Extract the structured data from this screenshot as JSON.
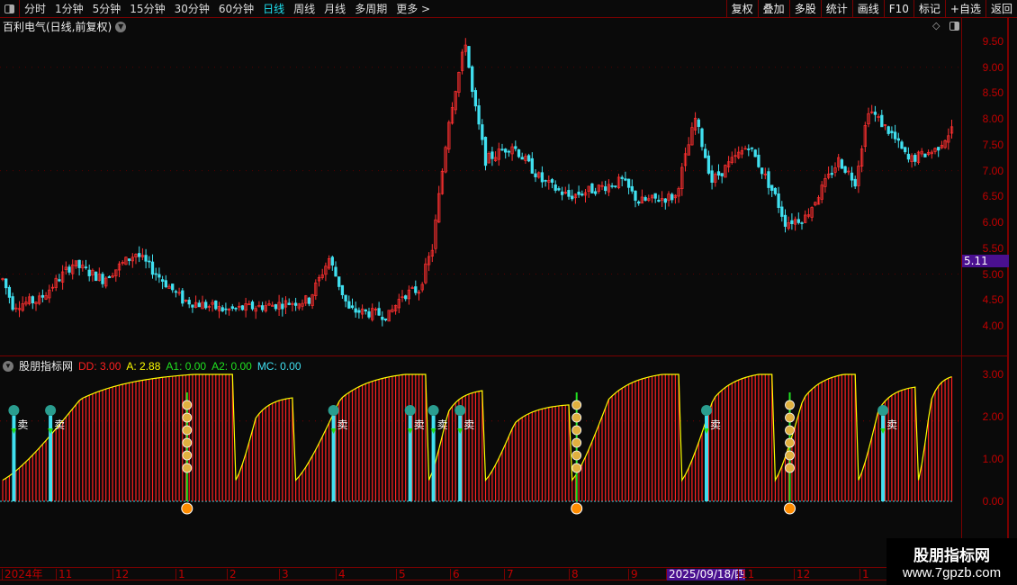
{
  "toolbar": {
    "periods": [
      "分时",
      "1分钟",
      "5分钟",
      "15分钟",
      "30分钟",
      "60分钟",
      "日线",
      "周线",
      "月线",
      "多周期",
      "更多 >"
    ],
    "active_period": "日线",
    "tools": [
      "复权",
      "叠加",
      "多股",
      "统计",
      "画线",
      "F10",
      "标记",
      "+自选",
      "返回"
    ]
  },
  "main": {
    "title": "百利电气(日线,前复权)",
    "current_price": "5.11",
    "y_ticks": [
      "9.50",
      "9.00",
      "8.50",
      "8.00",
      "7.50",
      "7.00",
      "6.50",
      "6.00",
      "5.50",
      "5.00",
      "4.50",
      "4.00"
    ]
  },
  "indicator": {
    "name": "股朋指标网",
    "dd": "DD: 3.00",
    "a": "A: 2.88",
    "a1": "A1: 0.00",
    "a2": "A2: 0.00",
    "mc": "MC: 0.00",
    "y_ticks": [
      "3.00",
      "2.00",
      "1.00",
      "0.00"
    ],
    "sell_label": "卖",
    "sell_signals": [
      2,
      13,
      98,
      121,
      128,
      136,
      210,
      263
    ],
    "buy_signals": [
      54,
      171,
      235
    ]
  },
  "date_axis": {
    "labels": [
      "2024年",
      "11",
      "12",
      "1",
      "2",
      "3",
      "4",
      "5",
      "6",
      "7",
      "8",
      "9",
      "2025/09/18/四",
      "11",
      "12",
      "1"
    ],
    "highlight": "2025/09/18/四"
  },
  "watermark": {
    "line1": "股朋指标网",
    "line2": "www.7gpzb.com"
  },
  "colors": {
    "up": "#ff3030",
    "down": "#40e0f0",
    "curve": "#ffff00",
    "bars": "#ff2020"
  },
  "chart_data": {
    "type": "candlestick",
    "price_path": [
      [
        0,
        4.9
      ],
      [
        3,
        4.4
      ],
      [
        11,
        4.5
      ],
      [
        21,
        5.2
      ],
      [
        30,
        4.9
      ],
      [
        40,
        5.4
      ],
      [
        54,
        4.5
      ],
      [
        67,
        4.3
      ],
      [
        81,
        4.4
      ],
      [
        92,
        4.5
      ],
      [
        98,
        5.3
      ],
      [
        104,
        4.3
      ],
      [
        116,
        4.2
      ],
      [
        120,
        4.6
      ],
      [
        125,
        4.7
      ],
      [
        129,
        5.5
      ],
      [
        134,
        8.0
      ],
      [
        139,
        9.5
      ],
      [
        141,
        8.5
      ],
      [
        145,
        7.2
      ],
      [
        153,
        7.5
      ],
      [
        162,
        6.8
      ],
      [
        170,
        6.5
      ],
      [
        186,
        6.8
      ],
      [
        191,
        6.4
      ],
      [
        202,
        6.5
      ],
      [
        208,
        8.0
      ],
      [
        213,
        6.8
      ],
      [
        224,
        7.5
      ],
      [
        232,
        6.5
      ],
      [
        235,
        6.0
      ],
      [
        241,
        6.1
      ],
      [
        251,
        7.2
      ],
      [
        256,
        6.8
      ],
      [
        260,
        8.2
      ],
      [
        267,
        7.7
      ],
      [
        272,
        7.2
      ],
      [
        280,
        7.4
      ],
      [
        285,
        7.8
      ]
    ],
    "indicator_cycles": [
      [
        0,
        70,
        3.0
      ],
      [
        70,
        88,
        2.3
      ],
      [
        88,
        128,
        3.0
      ],
      [
        128,
        145,
        2.5
      ],
      [
        145,
        171,
        2.1
      ],
      [
        171,
        204,
        3.0
      ],
      [
        204,
        232,
        3.0
      ],
      [
        232,
        257,
        3.0
      ],
      [
        257,
        275,
        2.6
      ],
      [
        275,
        286,
        2.9
      ]
    ]
  }
}
